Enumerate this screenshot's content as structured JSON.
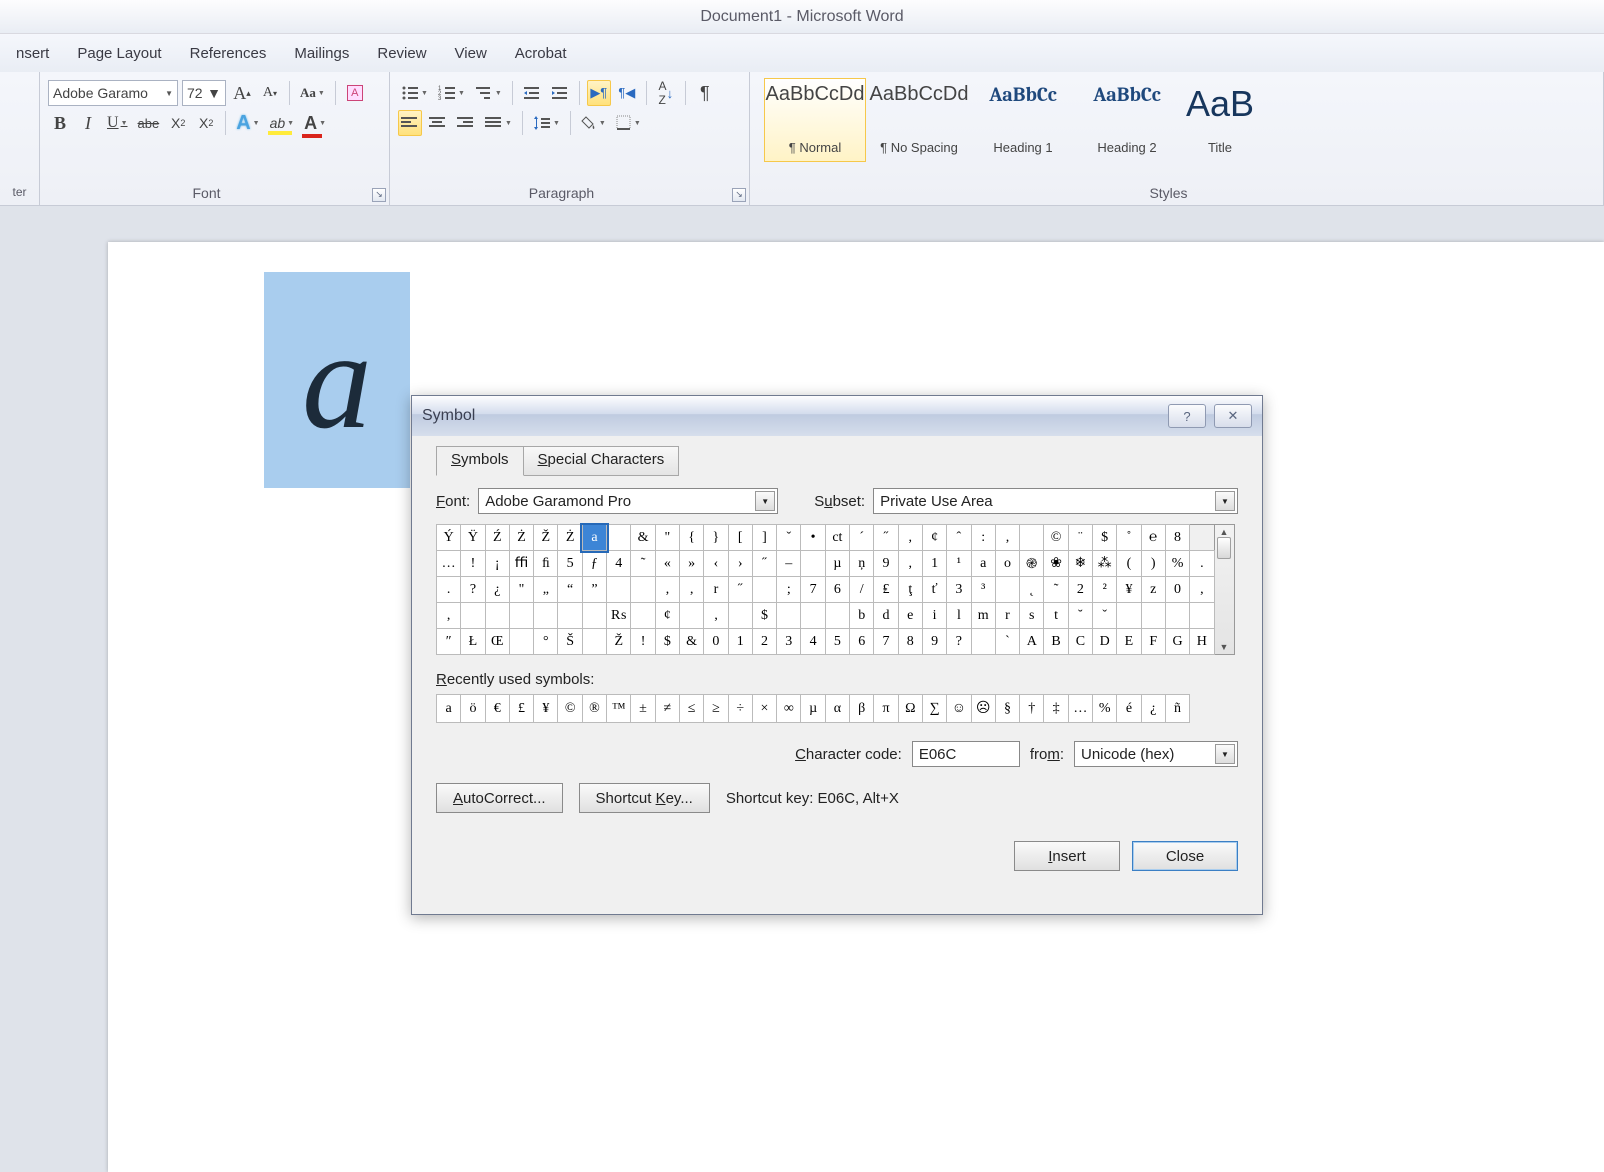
{
  "title": "Document1 - Microsoft Word",
  "tabs": [
    "nsert",
    "Page Layout",
    "References",
    "Mailings",
    "Review",
    "View",
    "Acrobat"
  ],
  "clipboard_label": "ter",
  "font": {
    "group_label": "Font",
    "name": "Adobe Garamo",
    "size": "72"
  },
  "para": {
    "group_label": "Paragraph"
  },
  "styles": {
    "group_label": "Styles",
    "items": [
      {
        "sample": "AaBbCcDd",
        "name": "¶ Normal",
        "cls": ""
      },
      {
        "sample": "AaBbCcDd",
        "name": "¶ No Spacing",
        "cls": ""
      },
      {
        "sample": "AaBbCc",
        "name": "Heading 1",
        "cls": "blue"
      },
      {
        "sample": "AaBbCc",
        "name": "Heading 2",
        "cls": "blue"
      },
      {
        "sample": "AaB",
        "name": "Title",
        "cls": "big"
      }
    ]
  },
  "doc_char": "a",
  "dlg": {
    "title": "Symbol",
    "tab_symbols": "Symbols",
    "tab_special": "Special Characters",
    "font_label": "Font:",
    "font_value": "Adobe Garamond Pro",
    "subset_label": "Subset:",
    "subset_value": "Private Use Area",
    "recent_label": "Recently used symbols:",
    "char_code_label": "Character code:",
    "char_code_value": "E06C",
    "from_label": "from:",
    "from_value": "Unicode (hex)",
    "autocorrect": "AutoCorrect...",
    "shortcut": "Shortcut Key...",
    "shortcut_text": "Shortcut key: E06C, Alt+X",
    "insert": "Insert",
    "close": "Close",
    "grid": [
      [
        "Ý",
        "Ÿ",
        "Ź",
        "Ż",
        "Ž",
        "Ż",
        "a",
        "",
        "&",
        "\"",
        "{",
        "}",
        "[",
        "]",
        "ˇ",
        "•",
        "ct",
        "ˊ",
        "˝",
        ",",
        "¢",
        "ˆ",
        ":",
        ",",
        "",
        "©",
        "¨",
        "$",
        "˚",
        "℮",
        "8"
      ],
      [
        "…",
        "!",
        "¡",
        "ﬃ",
        "ﬁ",
        "5",
        "ƒ",
        "4",
        "˜",
        "«",
        "»",
        "‹",
        "›",
        "˝",
        "–",
        "",
        "µ",
        "ņ",
        "9",
        ",",
        "1",
        "¹",
        "a",
        "o",
        "֎",
        "❀",
        "❄",
        "⁂",
        "(",
        ")",
        "%",
        "."
      ],
      [
        ".",
        "?",
        "¿",
        "\"",
        "„",
        "“",
        "”",
        "",
        "",
        "‚",
        "‚",
        "r",
        "˝",
        "",
        ";",
        "7",
        "6",
        "/",
        "₤",
        "ţ",
        "ť",
        "3",
        "³",
        "",
        "˛",
        "˜",
        "2",
        "²",
        "¥",
        "z",
        "0",
        ","
      ],
      [
        ",",
        "",
        "",
        "",
        "",
        "",
        "",
        "₨",
        "",
        "¢",
        "",
        "‚",
        "",
        "$",
        "",
        "",
        "",
        "b",
        "d",
        "e",
        "i",
        "l",
        "m",
        "r",
        "s",
        "t",
        "˘",
        "ˇ",
        "",
        "",
        "",
        ""
      ],
      [
        "″",
        "Ł",
        "Œ",
        "",
        "°",
        "Š",
        "",
        "Ž",
        "!",
        "$",
        "&",
        "0",
        "1",
        "2",
        "3",
        "4",
        "5",
        "6",
        "7",
        "8",
        "9",
        "?",
        "",
        "ˋ",
        "A",
        "B",
        "C",
        "D",
        "E",
        "F",
        "G",
        "H"
      ]
    ],
    "sel_row": 0,
    "sel_col": 6,
    "recent": [
      "a",
      "ö",
      "€",
      "£",
      "¥",
      "©",
      "®",
      "™",
      "±",
      "≠",
      "≤",
      "≥",
      "÷",
      "×",
      "∞",
      "µ",
      "α",
      "β",
      "π",
      "Ω",
      "∑",
      "☺",
      "☹",
      "§",
      "†",
      "‡",
      "…",
      "%",
      "é",
      "¿",
      "ñ"
    ]
  }
}
